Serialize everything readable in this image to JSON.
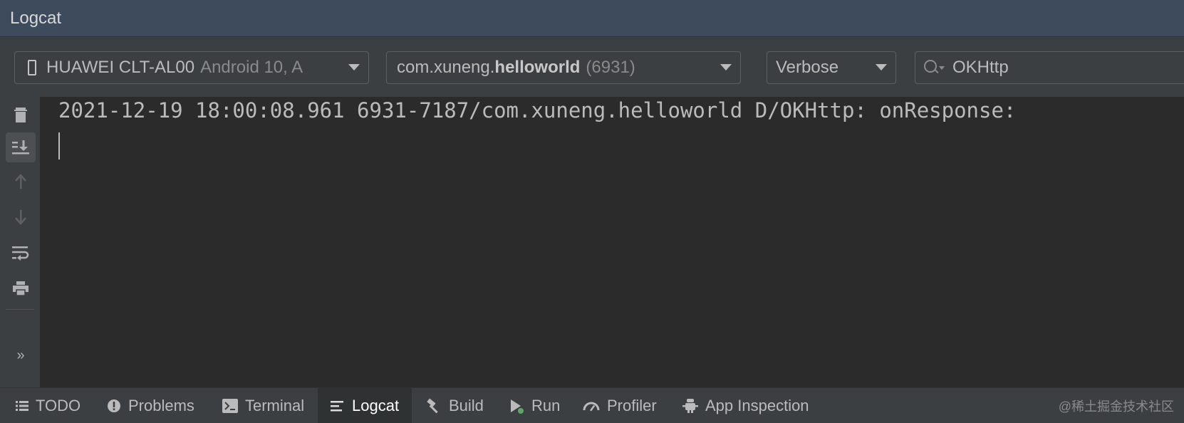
{
  "window": {
    "title": "Logcat"
  },
  "toolbar": {
    "device": {
      "name": "HUAWEI CLT-AL00",
      "detail": "Android 10, A"
    },
    "process": {
      "prefix": "com.xuneng.",
      "name": "helloworld",
      "pid": "(6931)"
    },
    "log_level": "Verbose",
    "search": {
      "value": "OKHttp"
    }
  },
  "sidebar": {
    "buttons": [
      {
        "name": "delete-icon",
        "state": "enabled"
      },
      {
        "name": "scroll-to-end-icon",
        "state": "active"
      },
      {
        "name": "up-arrow-icon",
        "state": "disabled"
      },
      {
        "name": "down-arrow-icon",
        "state": "disabled"
      },
      {
        "name": "soft-wrap-icon",
        "state": "enabled"
      },
      {
        "name": "print-icon",
        "state": "enabled"
      },
      {
        "name": "more-icon",
        "label": "»"
      }
    ]
  },
  "log": {
    "lines": [
      "2021-12-19 18:00:08.961 6931-7187/com.xuneng.helloworld D/OKHttp: onResponse:"
    ]
  },
  "bottom_tabs": [
    {
      "label": "TODO",
      "icon": "list-icon"
    },
    {
      "label": "Problems",
      "icon": "warning-icon"
    },
    {
      "label": "Terminal",
      "icon": "terminal-icon"
    },
    {
      "label": "Logcat",
      "icon": "logcat-icon",
      "active": true
    },
    {
      "label": "Build",
      "icon": "hammer-icon"
    },
    {
      "label": "Run",
      "icon": "run-icon"
    },
    {
      "label": "Profiler",
      "icon": "gauge-icon"
    },
    {
      "label": "App Inspection",
      "icon": "inspect-icon"
    }
  ],
  "watermark": "@稀土掘金技术社区",
  "colors": {
    "title_bar": "#3d4b5c",
    "panel": "#3c3f41",
    "editor": "#2b2b2b",
    "text": "#bbbbbb",
    "run_indicator": "#59a869"
  }
}
